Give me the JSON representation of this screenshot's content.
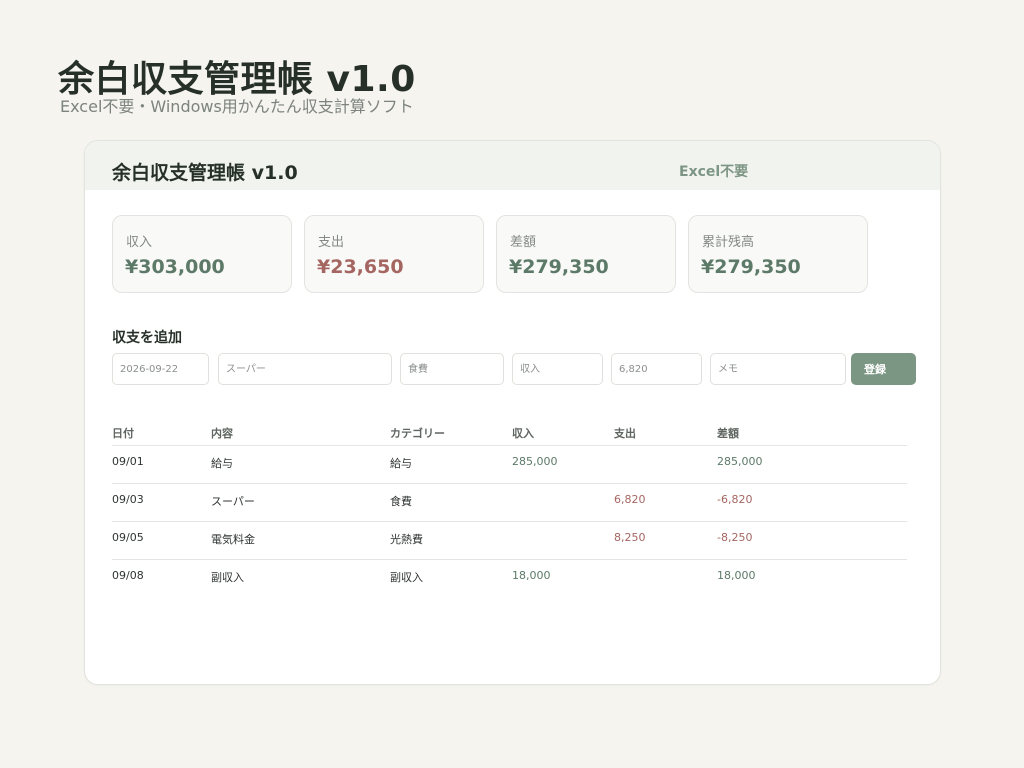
{
  "page": {
    "title": "余白収支管理帳 v1.0",
    "subtitle": "Excel不要・Windows用かんたん収支計算ソフト"
  },
  "window": {
    "title": "余白収支管理帳 v1.0",
    "badge": "Excel不要"
  },
  "summary": {
    "income": {
      "label": "収入",
      "value": "¥303,000"
    },
    "expense": {
      "label": "支出",
      "value": "¥23,650"
    },
    "difference": {
      "label": "差額",
      "value": "¥279,350"
    },
    "balance": {
      "label": "累計残高",
      "value": "¥279,350"
    }
  },
  "form": {
    "title": "収支を追加",
    "date": "2026-09-22",
    "description": "スーパー",
    "category": "食費",
    "type": "収入",
    "amount": "6,820",
    "memo_placeholder": "メモ",
    "submit_label": "登録"
  },
  "table": {
    "headers": {
      "date": "日付",
      "description": "内容",
      "category": "カテゴリー",
      "income": "収入",
      "expense": "支出",
      "difference": "差額"
    },
    "rows": [
      {
        "date": "09/01",
        "description": "給与",
        "category": "給与",
        "income": "285,000",
        "expense": "",
        "difference": "285,000"
      },
      {
        "date": "09/03",
        "description": "スーパー",
        "category": "食費",
        "income": "",
        "expense": "6,820",
        "difference": "-6,820"
      },
      {
        "date": "09/05",
        "description": "電気料金",
        "category": "光熱費",
        "income": "",
        "expense": "8,250",
        "difference": "-8,250"
      },
      {
        "date": "09/08",
        "description": "副収入",
        "category": "副収入",
        "income": "18,000",
        "expense": "",
        "difference": "18,000"
      }
    ]
  },
  "colors": {
    "positive": "#5d7a68",
    "negative": "#a56662",
    "accent": "#7b9683",
    "background": "#f5f4ef"
  }
}
